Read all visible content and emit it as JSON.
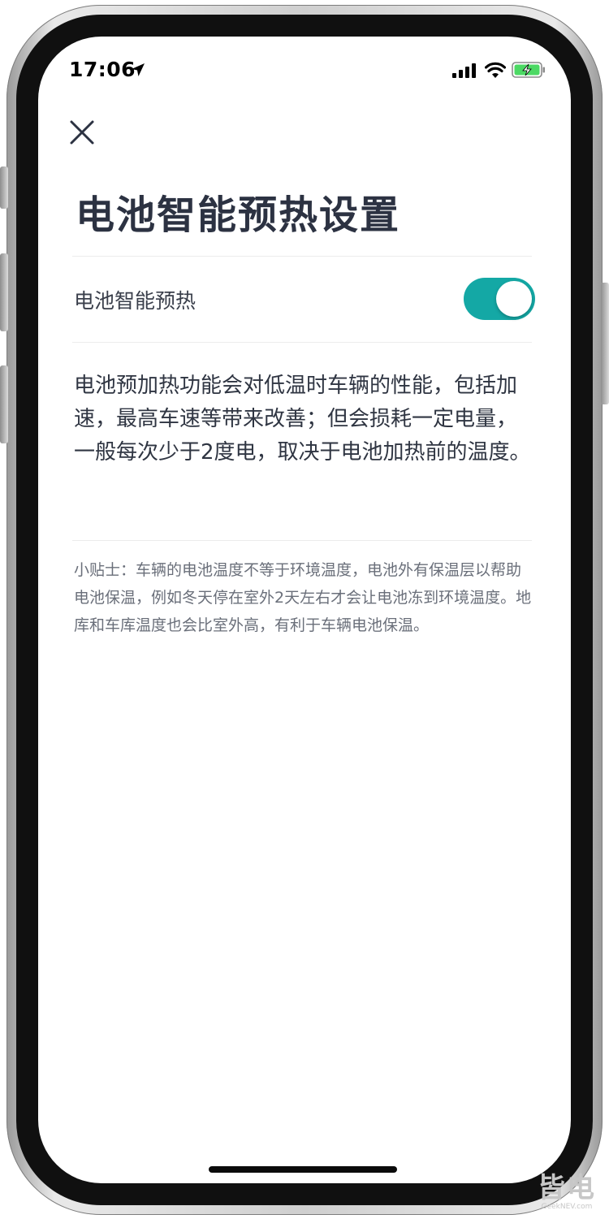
{
  "status_bar": {
    "time": "17:06",
    "location_icon": "location-arrow-icon",
    "signal_icon": "cellular-signal-icon",
    "wifi_icon": "wifi-icon",
    "battery_icon": "battery-charging-icon"
  },
  "header": {
    "close_icon": "close-icon",
    "title": "电池智能预热设置"
  },
  "setting": {
    "label": "电池智能预热",
    "toggle_state": "on",
    "toggle_color": "#14a8a5"
  },
  "description": "电池预加热功能会对低温时车辆的性能，包括加速，最高车速等带来改善；但会损耗一定电量，一般每次少于2度电，取决于电池加热前的温度。",
  "tip": "小贴士：车辆的电池温度不等于环境温度，电池外有保温层以帮助电池保温，例如冬天停在室外2天左右才会让电池冻到环境温度。地库和车库温度也会比室外高，有利于车辆电池保温。",
  "watermark": {
    "text": "皆电",
    "subtext": "GeekNEV.com"
  }
}
